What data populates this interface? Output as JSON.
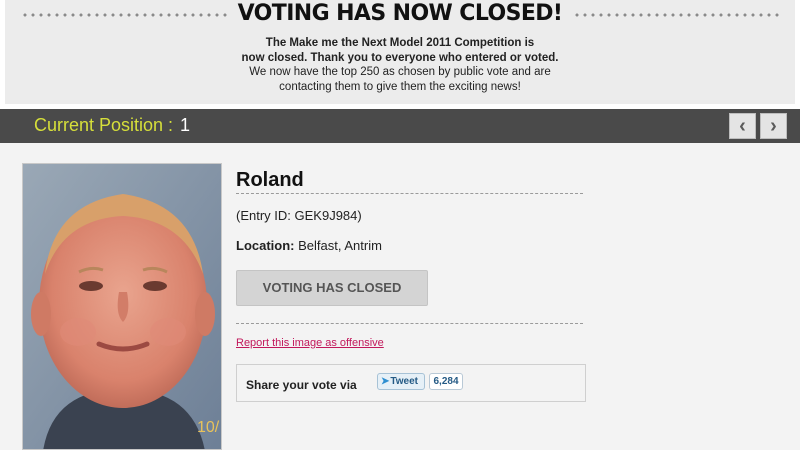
{
  "banner": {
    "title": "VOTING HAS NOW CLOSED!",
    "line1": "The Make me the Next Model 2011 Competition is",
    "line2": "now closed. Thank you to everyone who entered or voted.",
    "line3": "We now have the top 250 as chosen by public vote and are",
    "line4": "contacting them to give them the exciting news!"
  },
  "position_bar": {
    "label": "Current Position :",
    "value": "1",
    "prev_icon": "chevron-left-icon",
    "prev_glyph": "‹",
    "next_icon": "chevron-right-icon",
    "next_glyph": "›"
  },
  "entry": {
    "name": "Roland",
    "entry_id": "(Entry ID: GEK9J984)",
    "location_label": "Location:",
    "location_value": "Belfast, Antrim",
    "photo_caption": "10/",
    "voting_button": "VOTING HAS CLOSED",
    "report_link": "Report this image as offensive"
  },
  "share": {
    "label": "Share your vote via",
    "tweet_icon": "twitter-bird-icon",
    "tweet_label": "Tweet",
    "tweet_count": "6,284"
  },
  "colors": {
    "position_bar_bg": "#4a4a4a",
    "position_label": "#d6df3a",
    "report_link": "#c2185b",
    "tweet_text": "#245a85"
  }
}
